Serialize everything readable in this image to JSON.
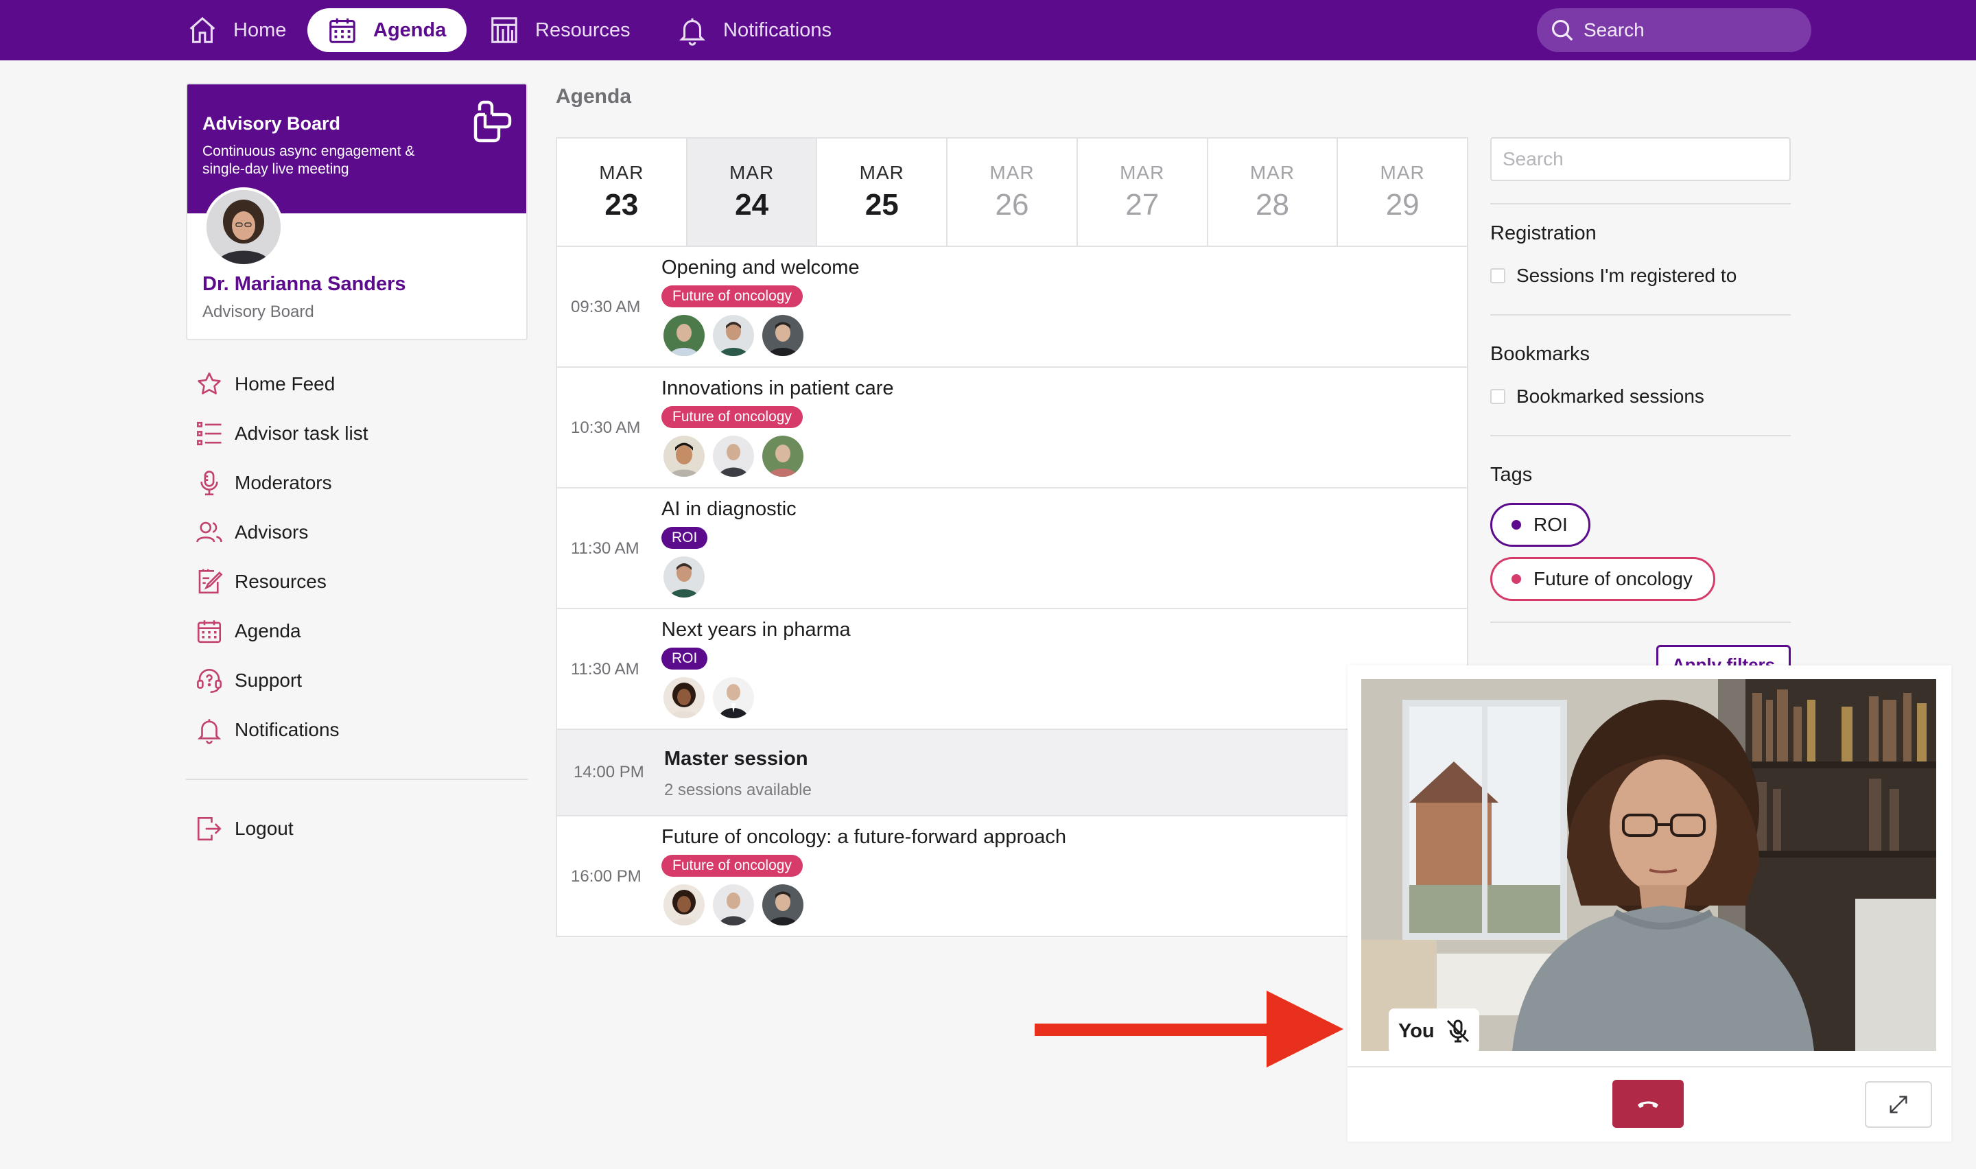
{
  "nav": {
    "items": [
      {
        "label": "Home",
        "icon": "home-icon"
      },
      {
        "label": "Agenda",
        "icon": "calendar-icon",
        "active": true
      },
      {
        "label": "Resources",
        "icon": "resources-icon"
      },
      {
        "label": "Notifications",
        "icon": "bell-icon"
      }
    ],
    "search_placeholder": "Search"
  },
  "profile": {
    "board_title": "Advisory Board",
    "board_subtitle": "Continuous async engagement & single-day live meeting",
    "name": "Dr. Marianna Sanders",
    "role": "Advisory Board"
  },
  "menu": [
    {
      "label": "Home Feed",
      "icon": "star-icon"
    },
    {
      "label": "Advisor task list",
      "icon": "task-list-icon"
    },
    {
      "label": "Moderators",
      "icon": "microphone-icon"
    },
    {
      "label": "Advisors",
      "icon": "users-icon"
    },
    {
      "label": "Resources",
      "icon": "edit-doc-icon"
    },
    {
      "label": "Agenda",
      "icon": "calendar-icon"
    },
    {
      "label": "Support",
      "icon": "support-icon"
    },
    {
      "label": "Notifications",
      "icon": "bell-icon"
    }
  ],
  "logout_label": "Logout",
  "agenda": {
    "title": "Agenda",
    "days": [
      {
        "month": "MAR",
        "day": "23"
      },
      {
        "month": "MAR",
        "day": "24",
        "selected": true
      },
      {
        "month": "MAR",
        "day": "25"
      },
      {
        "month": "MAR",
        "day": "26"
      },
      {
        "month": "MAR",
        "day": "27"
      },
      {
        "month": "MAR",
        "day": "28"
      },
      {
        "month": "MAR",
        "day": "29"
      }
    ],
    "sessions": [
      {
        "time": "09:30 AM",
        "title": "Opening and welcome",
        "tag": "Future of oncology"
      },
      {
        "time": "10:30 AM",
        "title": "Innovations in patient care",
        "tag": "Future of oncology"
      },
      {
        "time": "11:30 AM",
        "title": "AI in diagnostic",
        "tag": "ROI"
      },
      {
        "time": "11:30 AM",
        "title": "Next years in pharma",
        "tag": "ROI"
      },
      {
        "time": "16:00 PM",
        "title": "Future of oncology: a future-forward approach",
        "tag": "Future of oncology"
      }
    ],
    "master": {
      "time": "14:00 PM",
      "title": "Master session",
      "subtitle": "2 sessions available"
    }
  },
  "filters": {
    "search_placeholder": "Search",
    "registration_heading": "Registration",
    "registration_option": "Sessions I'm registered to",
    "bookmarks_heading": "Bookmarks",
    "bookmarks_option": "Bookmarked sessions",
    "tags_heading": "Tags",
    "tags": [
      {
        "label": "ROI",
        "color": "#5b0b8c"
      },
      {
        "label": "Future of oncology",
        "color": "#d63b6a"
      }
    ],
    "apply_label": "Apply filters"
  },
  "video": {
    "self_label": "You",
    "mic_icon": "mic-muted-icon",
    "hangup_icon": "phone-hangup-icon",
    "expand_icon": "expand-icon"
  },
  "colors": {
    "brand": "#5b0b8c",
    "oncology": "#d63b6a",
    "hangup": "#b02a47",
    "arrow": "#e8301c"
  }
}
